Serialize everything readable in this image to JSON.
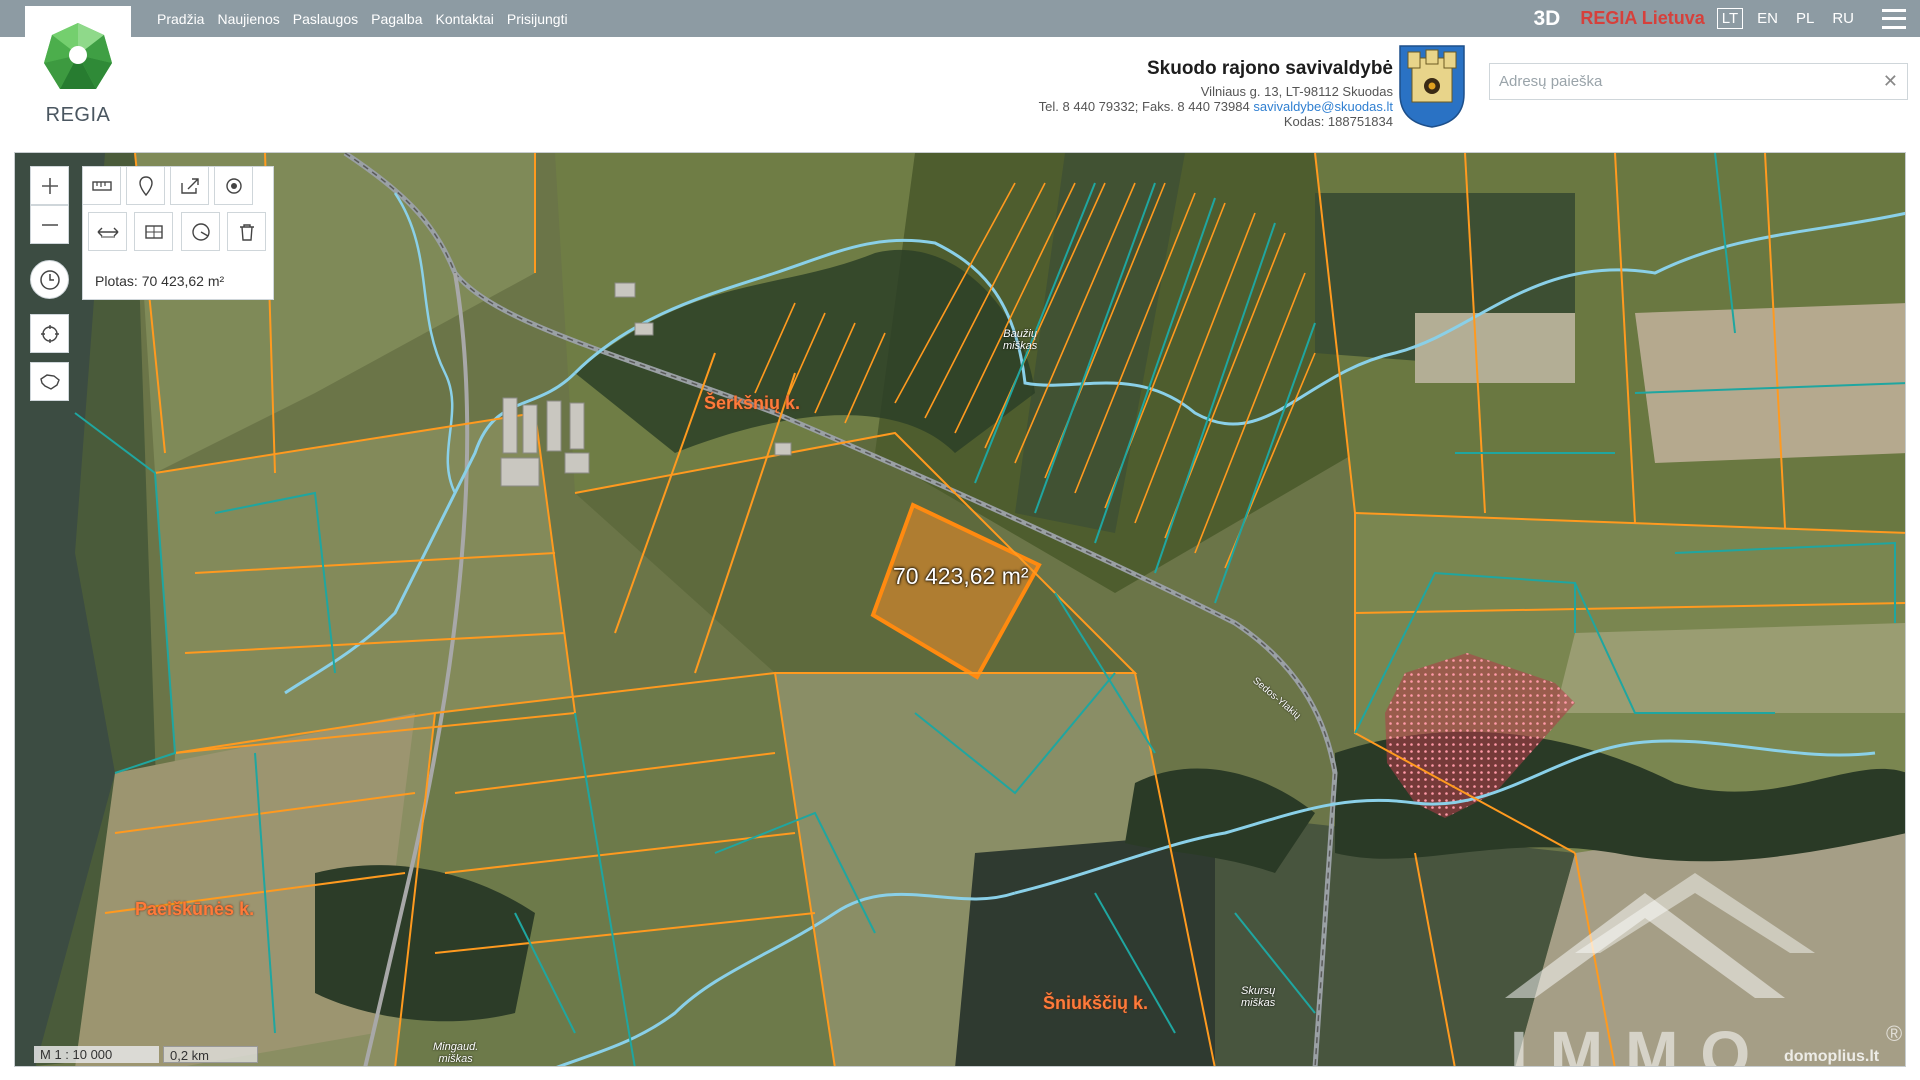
{
  "nav": {
    "items": [
      "Pradžia",
      "Naujienos",
      "Paslaugos",
      "Pagalba",
      "Kontaktai",
      "Prisijungti"
    ]
  },
  "topbar": {
    "btn_3d": "3D",
    "regia_lietuva": "REGIA Lietuva",
    "languages": [
      "LT",
      "EN",
      "PL",
      "RU"
    ],
    "active_language": "LT"
  },
  "logo": {
    "text": "REGIA"
  },
  "municipality": {
    "name": "Skuodo rajono savivaldybė",
    "address": "Vilniaus g. 13, LT-98112 Skuodas",
    "phone_fax": "Tel. 8 440 79332; Faks. 8 440 73984",
    "email": "savivaldybe@skuodas.lt",
    "code": "Kodas: 188751834"
  },
  "search": {
    "placeholder": "Adresų paieška",
    "value": ""
  },
  "measure": {
    "plotas": "Plotas: 70 423,62 m²"
  },
  "map": {
    "area_label": "70 423,62 m²",
    "places": {
      "serksniu": "Šerkšnių k.",
      "paeiskunes": "Paeiškūnės k.",
      "sniuksciu": "Šniukščių k."
    },
    "forests": {
      "bauziu_1": "Baužių",
      "bauziu_2": "miškas",
      "skurs_1": "Skursų",
      "skurs_2": "miškas",
      "mingaud_1": "Mingaud.",
      "mingaud_2": "miškas"
    },
    "road": "Sedos-Ylakių",
    "scale_m": "M 1 : 10 000",
    "scale_km": "0,2 km"
  },
  "watermark": {
    "text": "IMMO",
    "site": "domoplius.lt",
    "reg": "®"
  },
  "colors": {
    "topbar": "#8d9ba3",
    "parcel_orange": "#ff9a1f",
    "parcel_teal": "#1fa6a0",
    "selected_fill": "#f28c28",
    "river": "#8ad0e8",
    "accent_red": "#d6403b",
    "link_blue": "#2f7fd1"
  }
}
